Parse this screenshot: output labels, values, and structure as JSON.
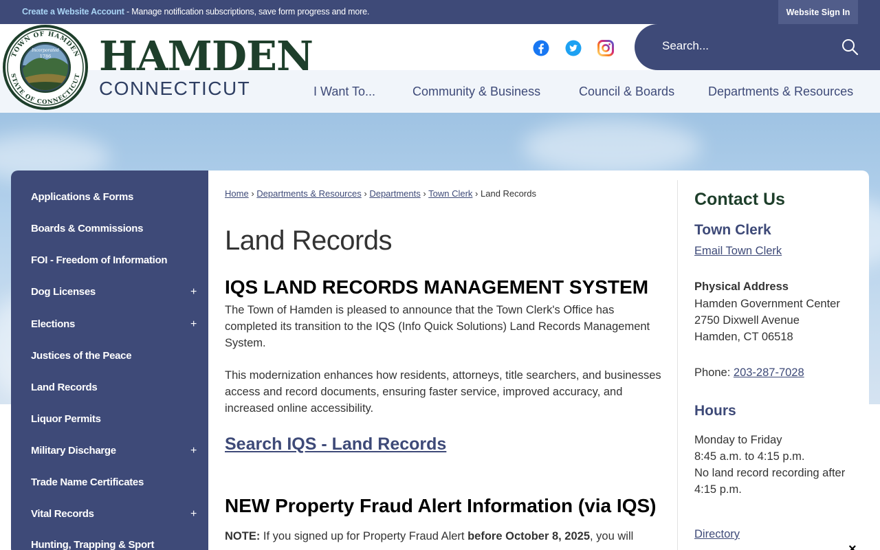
{
  "topbar": {
    "create_account_link": "Create a Website Account",
    "message": " - Manage notification subscriptions, save form progress and more.",
    "sign_in": "Website Sign In"
  },
  "logo": {
    "seal_text_top": "TOWN OF HAMDEN",
    "seal_text_bottom": "STATE OF CONNECTICUT",
    "seal_incorporated": "Incorporated",
    "seal_year": "1786",
    "name": "HAMDEN",
    "state": "CONNECTICUT"
  },
  "social": [
    "facebook-icon",
    "twitter-icon",
    "instagram-icon"
  ],
  "search": {
    "placeholder": "Search..."
  },
  "nav": [
    "I Want To...",
    "Community & Business",
    "Council & Boards",
    "Departments & Resources"
  ],
  "sidebar": {
    "items": [
      {
        "label": "Applications & Forms",
        "expandable": false
      },
      {
        "label": "Boards & Commissions",
        "expandable": false
      },
      {
        "label": "FOI - Freedom of Information",
        "expandable": false
      },
      {
        "label": "Dog Licenses",
        "expandable": true
      },
      {
        "label": "Elections",
        "expandable": true
      },
      {
        "label": "Justices of the Peace",
        "expandable": false
      },
      {
        "label": "Land Records",
        "expandable": false
      },
      {
        "label": "Liquor Permits",
        "expandable": false
      },
      {
        "label": "Military Discharge",
        "expandable": true
      },
      {
        "label": "Trade Name Certificates",
        "expandable": false
      },
      {
        "label": "Vital Records",
        "expandable": true
      },
      {
        "label": "Hunting, Trapping & Sport",
        "expandable": false
      }
    ],
    "expand_symbol": "+"
  },
  "breadcrumb": {
    "links": [
      "Home",
      "Departments & Resources",
      "Departments",
      "Town Clerk"
    ],
    "separator": "›",
    "current": "Land Records"
  },
  "main": {
    "title": "Land Records",
    "iqs_heading": "IQS LAND RECORDS MANAGEMENT SYSTEM",
    "iqs_para1": "The Town of Hamden is pleased to announce that the Town Clerk's Office has completed its transition to the IQS (Info Quick Solutions) Land Records Management System.",
    "iqs_para2": "This modernization enhances how residents, attorneys, title searchers, and businesses access and record documents, ensuring faster service, improved accuracy, and increased online accessibility.",
    "search_link": "Search IQS - Land Records",
    "fraud_heading": "NEW Property Fraud Alert Information (via IQS)",
    "note_label": "NOTE:",
    "note_text1": " If you signed up for Property Fraud Alert ",
    "note_bold": "before October 8, 2025",
    "note_text2": ", you will"
  },
  "contact": {
    "heading": "Contact Us",
    "dept": "Town Clerk",
    "email_link": "Email Town Clerk",
    "address_label": "Physical Address",
    "address_lines": [
      "Hamden Government Center",
      "2750 Dixwell Avenue",
      "Hamden, CT 06518"
    ],
    "phone_label": "Phone: ",
    "phone": "203-287-7028",
    "hours_heading": "Hours",
    "hours_lines": [
      "Monday to Friday",
      "8:45 a.m. to 4:15 p.m.",
      "No land record recording after",
      "4:15 p.m."
    ],
    "directory_link": "Directory"
  },
  "close_symbol": "×"
}
